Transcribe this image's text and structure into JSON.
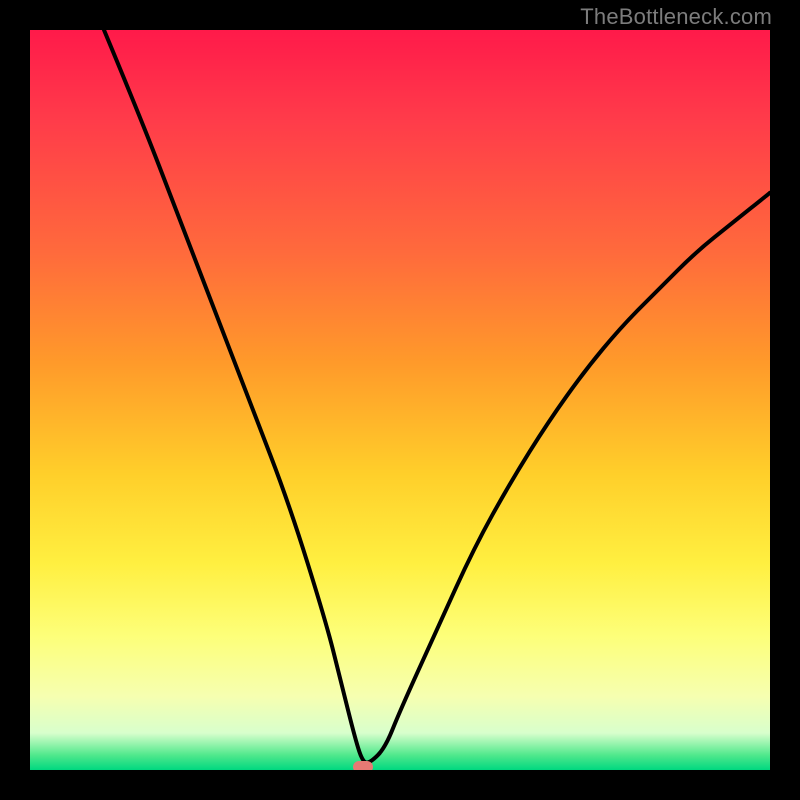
{
  "watermark": "TheBottleneck.com",
  "colors": {
    "frame": "#000000",
    "gradient_top": "#ff1a4a",
    "gradient_mid": "#ffef40",
    "gradient_bottom": "#00d880",
    "curve": "#000000",
    "marker": "#e77a74"
  },
  "chart_data": {
    "type": "line",
    "title": "",
    "xlabel": "",
    "ylabel": "",
    "xlim": [
      0,
      100
    ],
    "ylim": [
      0,
      100
    ],
    "series": [
      {
        "name": "bottleneck-curve",
        "x": [
          10,
          15,
          20,
          25,
          30,
          35,
          40,
          42,
          44,
          45,
          46,
          48,
          50,
          55,
          60,
          65,
          70,
          75,
          80,
          85,
          90,
          95,
          100
        ],
        "values": [
          100,
          88,
          75,
          62,
          49,
          36,
          20,
          12,
          4,
          1,
          1,
          3,
          8,
          19,
          30,
          39,
          47,
          54,
          60,
          65,
          70,
          74,
          78
        ]
      }
    ],
    "annotations": [
      {
        "name": "min-marker",
        "x": 45,
        "y": 0
      }
    ]
  }
}
